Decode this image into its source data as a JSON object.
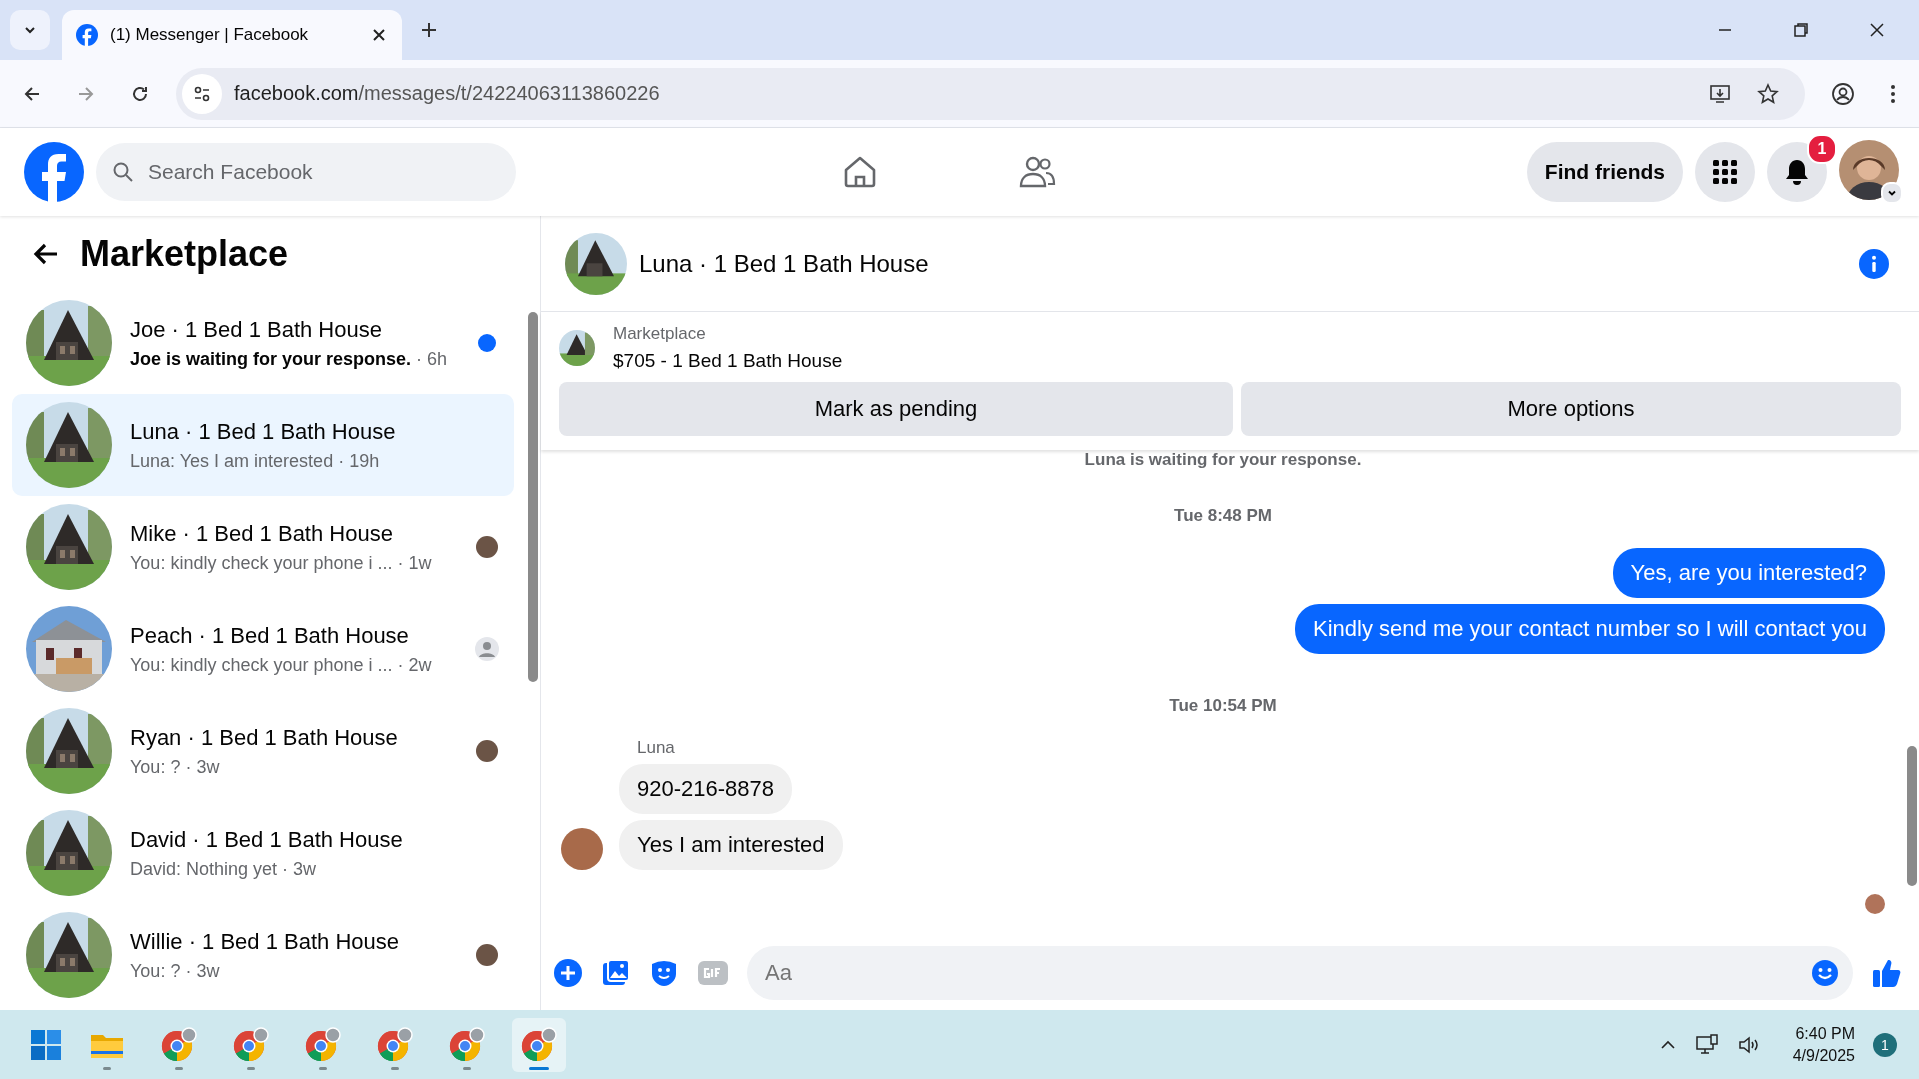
{
  "browser": {
    "tab_title": "(1) Messenger | Facebook",
    "url_domain": "facebook.com",
    "url_path": "/messages/t/24224063113860226"
  },
  "header": {
    "search_placeholder": "Search Facebook",
    "find_friends": "Find friends",
    "notification_count": "1"
  },
  "sidebar": {
    "title": "Marketplace",
    "conversations": [
      {
        "title": "Joe · 1 Bed 1 Bath House",
        "preview": "Joe is waiting for your response.",
        "time": "· 6h",
        "unread": true,
        "selected": false,
        "kind": "dot"
      },
      {
        "title": "Luna · 1 Bed 1 Bath House",
        "preview": "Luna: Yes I am interested",
        "time": "· 19h",
        "unread": false,
        "selected": true,
        "kind": "plain"
      },
      {
        "title": "Mike · 1 Bed 1 Bath House",
        "preview": "You: kindly check your phone i ...",
        "time": "· 1w",
        "unread": false,
        "selected": false,
        "kind": "avatar"
      },
      {
        "title": "Peach · 1 Bed 1 Bath House",
        "preview": "You: kindly check your phone i ...",
        "time": "· 2w",
        "unread": false,
        "selected": false,
        "kind": "silhouette"
      },
      {
        "title": "Ryan · 1 Bed 1 Bath House",
        "preview": "You: ?",
        "time": "· 3w",
        "unread": false,
        "selected": false,
        "kind": "avatar"
      },
      {
        "title": "David · 1 Bed 1 Bath House",
        "preview": "David: Nothing yet",
        "time": "· 3w",
        "unread": false,
        "selected": false,
        "kind": "plain"
      },
      {
        "title": "Willie · 1 Bed 1 Bath House",
        "preview": "You: ?",
        "time": "· 3w",
        "unread": false,
        "selected": false,
        "kind": "avatar"
      }
    ]
  },
  "chat": {
    "title": "Luna · 1 Bed 1 Bath House",
    "listing_label": "Marketplace",
    "listing_title": "$705 - 1 Bed 1 Bath House",
    "buttons": [
      "Mark as pending",
      "More options"
    ],
    "messages": [
      {
        "kind": "notice",
        "text": "Luna is waiting for your response."
      },
      {
        "kind": "timestamp",
        "text": "Tue 8:48 PM"
      },
      {
        "kind": "outgoing",
        "text": "Yes, are you interested?"
      },
      {
        "kind": "outgoing",
        "text": "Kindly send me your contact number so I will contact you"
      },
      {
        "kind": "timestamp",
        "text": "Tue 10:54 PM"
      },
      {
        "kind": "sender",
        "text": "Luna"
      },
      {
        "kind": "incoming",
        "text": "920-216-8878"
      },
      {
        "kind": "incoming",
        "text": "Yes I am interested"
      }
    ],
    "composer_placeholder": "Aa"
  },
  "taskbar": {
    "apps": [
      {
        "kind": "files",
        "selected": false
      },
      {
        "kind": "chrome",
        "selected": false
      },
      {
        "kind": "chrome",
        "selected": false
      },
      {
        "kind": "chrome",
        "selected": false
      },
      {
        "kind": "chrome",
        "selected": false
      },
      {
        "kind": "chrome",
        "selected": false
      },
      {
        "kind": "chrome",
        "selected": true
      }
    ],
    "time": "6:40 PM",
    "date": "4/9/2025",
    "notification_count": "1"
  }
}
